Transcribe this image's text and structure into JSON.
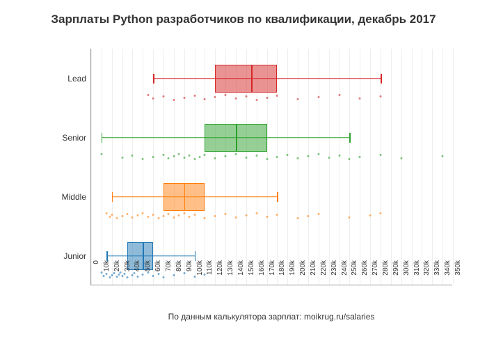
{
  "title": "Зарплаты Python разработчиков по квалификации, декабрь 2017",
  "x_caption": "По данным калькулятора зарплат: moikrug.ru/salaries",
  "x_ticks": [
    "0",
    "10k",
    "20k",
    "30k",
    "40k",
    "50k",
    "60k",
    "70k",
    "80k",
    "90k",
    "100k",
    "110k",
    "120k",
    "130k",
    "140k",
    "150k",
    "160k",
    "170k",
    "180k",
    "190k",
    "200k",
    "210k",
    "220k",
    "230k",
    "240k",
    "250k",
    "260k",
    "270k",
    "280k",
    "290k",
    "300k",
    "310k",
    "320k",
    "330k",
    "340k",
    "350k"
  ],
  "y_labels": [
    "Junior",
    "Middle",
    "Senior",
    "Lead"
  ],
  "chart_data": {
    "type": "box",
    "xlim": [
      0,
      350
    ],
    "categories": [
      "Junior",
      "Middle",
      "Senior",
      "Lead"
    ],
    "series": [
      {
        "name": "Junior",
        "color": "#1f77b4",
        "fill": "rgba(31,119,180,0.5)",
        "whisker_low": 15,
        "q1": 35,
        "median": 50,
        "q3": 60,
        "whisker_high": 100,
        "points": [
          10,
          12,
          15,
          18,
          20,
          22,
          25,
          27,
          28,
          30,
          32,
          35,
          40,
          42,
          45,
          50,
          55,
          60,
          65,
          70,
          80,
          90,
          100,
          110
        ]
      },
      {
        "name": "Middle",
        "color": "#ff7f0e",
        "fill": "rgba(255,127,14,0.5)",
        "whisker_low": 20,
        "q1": 70,
        "median": 90,
        "q3": 110,
        "whisker_high": 180,
        "points": [
          15,
          18,
          20,
          25,
          30,
          35,
          40,
          45,
          50,
          55,
          60,
          65,
          70,
          75,
          80,
          85,
          90,
          95,
          100,
          110,
          120,
          130,
          140,
          150,
          160,
          170,
          180,
          200,
          210,
          220,
          250,
          270,
          280
        ]
      },
      {
        "name": "Senior",
        "color": "#2ca02c",
        "fill": "rgba(44,160,44,0.5)",
        "whisker_low": 10,
        "q1": 110,
        "median": 140,
        "q3": 170,
        "whisker_high": 250,
        "points": [
          10,
          30,
          40,
          50,
          60,
          70,
          75,
          80,
          85,
          90,
          95,
          100,
          105,
          110,
          120,
          130,
          140,
          150,
          160,
          170,
          180,
          190,
          200,
          210,
          220,
          230,
          240,
          250,
          260,
          280,
          300,
          340
        ]
      },
      {
        "name": "Lead",
        "color": "#d62728",
        "fill": "rgba(214,39,40,0.5)",
        "whisker_low": 60,
        "q1": 120,
        "median": 155,
        "q3": 180,
        "whisker_high": 280,
        "points": [
          55,
          60,
          70,
          80,
          90,
          100,
          110,
          120,
          130,
          140,
          150,
          160,
          170,
          180,
          200,
          220,
          240,
          260,
          280
        ]
      }
    ]
  }
}
